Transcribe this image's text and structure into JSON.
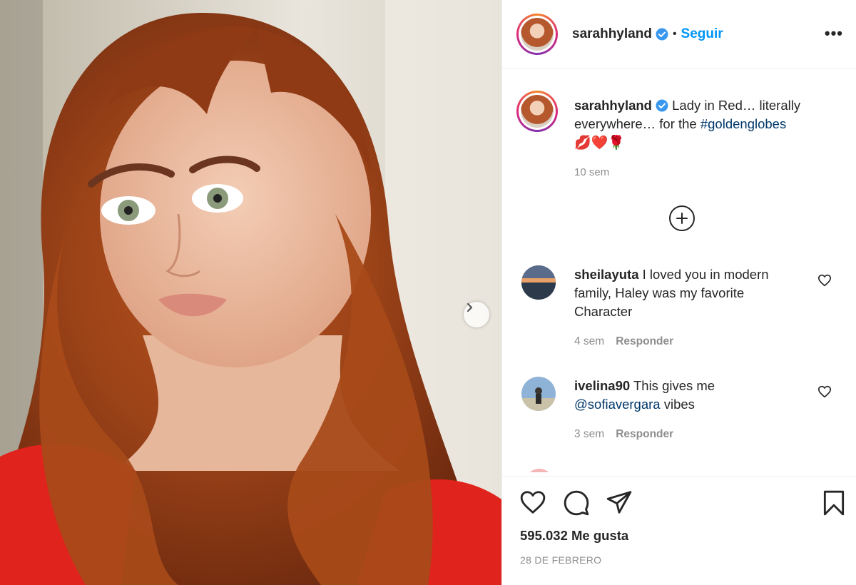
{
  "post": {
    "image_alt": "Portrait of a woman with long auburn hair wearing a red top",
    "carousel_next_icon": "chevron-right-icon"
  },
  "header": {
    "username": "sarahhyland",
    "verified_icon": "verified-badge-icon",
    "separator": "•",
    "follow_label": "Seguir",
    "more_label": "•••"
  },
  "caption": {
    "username": "sarahhyland",
    "text": " Lady in Red… literally everywhere… for the ",
    "hashtag": "#goldenglobes",
    "emojis": "💋❤️🌹",
    "time": "10 sem"
  },
  "load_more_icon": "plus-circle-icon",
  "comments": [
    {
      "username": "sheilayuta",
      "text": " I loved you in modern family, Haley was my favorite Character",
      "time": "4 sem",
      "reply_label": "Responder"
    },
    {
      "username": "ivelina90",
      "text_before": " This gives me ",
      "mention": "@sofiavergara",
      "text_after": " vibes",
      "time": "3 sem",
      "reply_label": "Responder"
    }
  ],
  "actions": {
    "like_icon": "heart-icon",
    "comment_icon": "comment-icon",
    "share_icon": "paper-plane-icon",
    "save_icon": "bookmark-icon",
    "likes_count": "595.032",
    "likes_label": " Me gusta",
    "date": "28 DE FEBRERO"
  },
  "colors": {
    "link_blue": "#0095f6",
    "hashtag_blue": "#00376b",
    "muted_text": "#8e8e8e",
    "border": "#efefef"
  }
}
